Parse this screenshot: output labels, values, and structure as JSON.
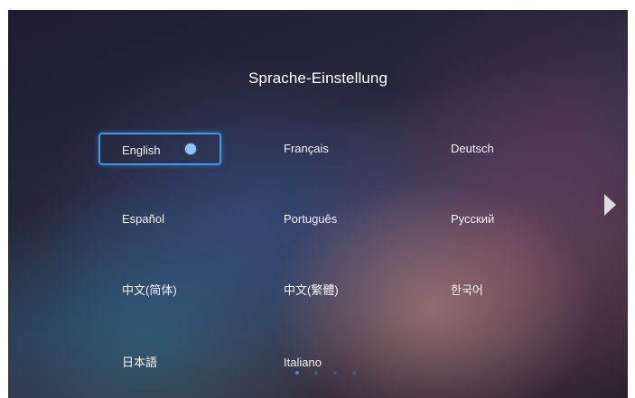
{
  "screen": {
    "title": "Sprache-Einstellung",
    "languages": [
      {
        "label": "English",
        "selected": true
      },
      {
        "label": "Français",
        "selected": false
      },
      {
        "label": "Deutsch",
        "selected": false
      },
      {
        "label": "Español",
        "selected": false
      },
      {
        "label": "Português",
        "selected": false
      },
      {
        "label": "Русский",
        "selected": false
      },
      {
        "label": "中文(简体)",
        "selected": false
      },
      {
        "label": "中文(繁體)",
        "selected": false
      },
      {
        "label": "한국어",
        "selected": false
      },
      {
        "label": "日本語",
        "selected": false
      },
      {
        "label": "Italiano",
        "selected": false
      }
    ],
    "next_arrow_icon": "chevron-right-icon",
    "radio_icon": "radio-selected-icon",
    "pagination": {
      "total_pages": 4,
      "current_page": 1
    },
    "colors": {
      "selection_border": "#3b9be6",
      "radio_dot": "#8fc5ff",
      "page_dot_active": "#3f95e6",
      "page_dot_inactive": "#2b5f9a"
    }
  }
}
